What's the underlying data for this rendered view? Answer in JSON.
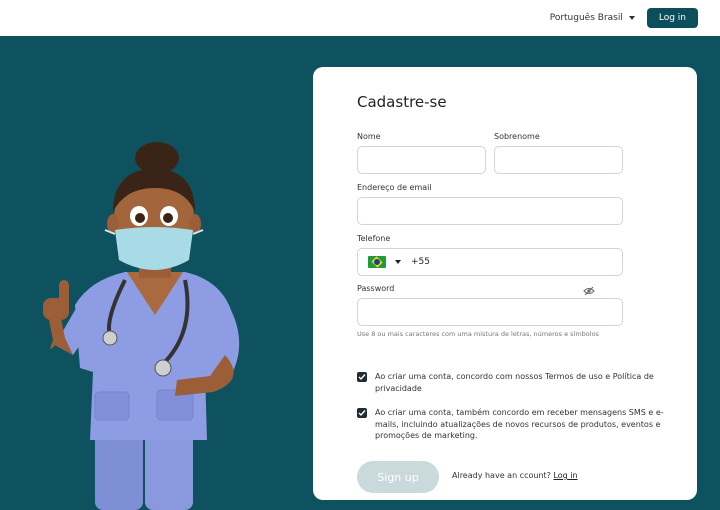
{
  "header": {
    "language": "Português Brasil",
    "login_button": "Log in"
  },
  "form": {
    "title": "Cadastre-se",
    "first_name_label": "Nome",
    "first_name_value": "",
    "last_name_label": "Sobrenome",
    "last_name_value": "",
    "email_label": "Endereço de email",
    "email_value": "",
    "phone_label": "Telefone",
    "phone_country": "brazil-flag",
    "phone_prefix": "+55",
    "password_label": "Password",
    "password_value": "",
    "password_hint": "Use 8 ou mais caracteres com uma mistura de letras, números e símbolos",
    "terms_checkbox": {
      "checked": true,
      "text": "Ao criar uma conta, concordo com nossos Termos de uso e Política de privacidade"
    },
    "sms_checkbox": {
      "checked": true,
      "text": "Ao criar uma conta, também concordo em receber mensagens SMS e e-mails, incluindo atualizações de novos recursos de produtos, eventos e promoções de marketing."
    },
    "signup_button": "Sign up",
    "already_text": "Already have an ccount?",
    "login_link": "Log in"
  },
  "colors": {
    "brand": "#0d525e",
    "button_primary": "#0b4f5c",
    "signup_disabled": "#c9d9dc",
    "checkbox": "#1f2d33"
  }
}
